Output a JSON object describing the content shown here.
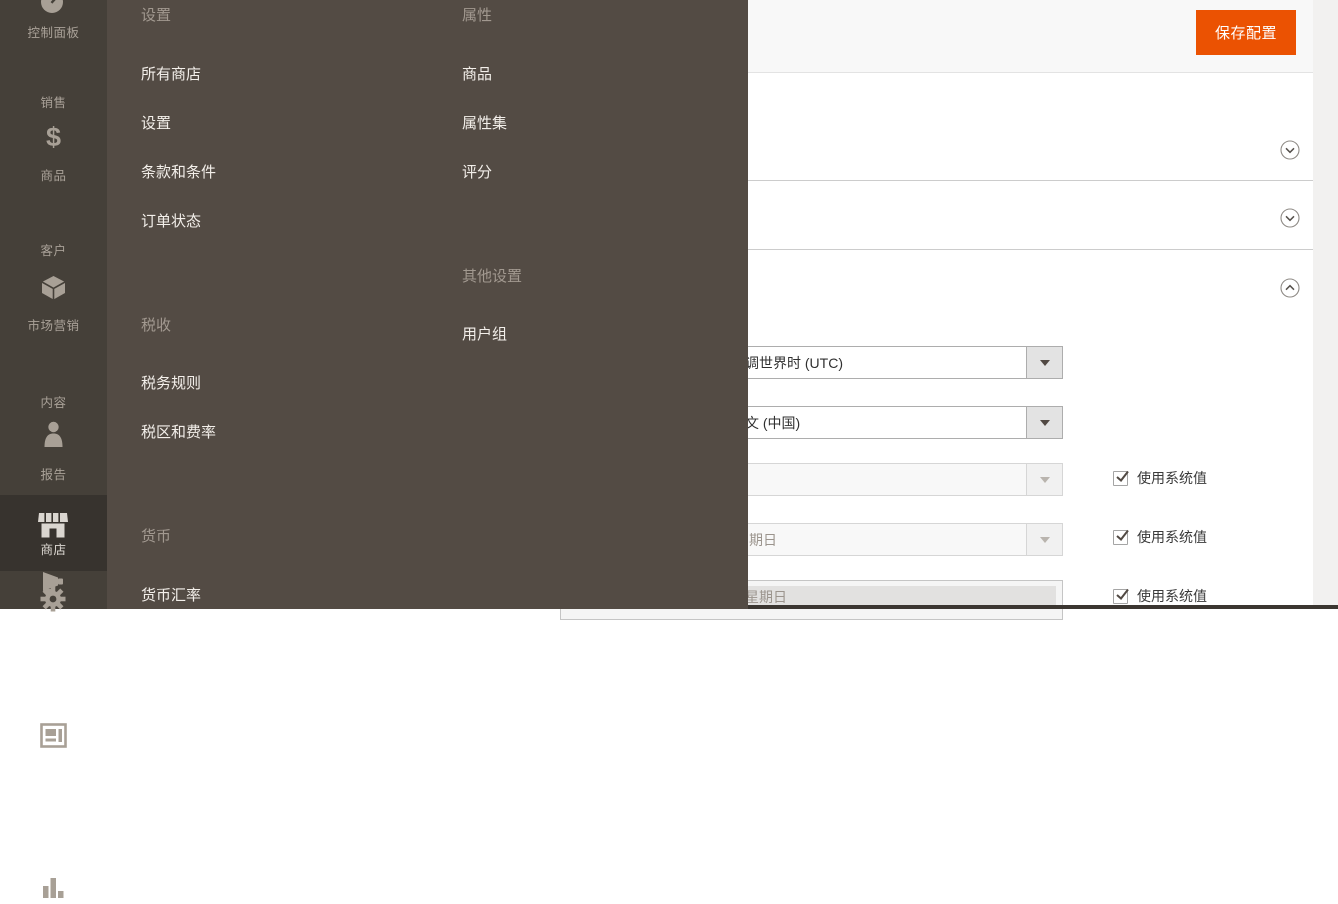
{
  "header": {
    "save_button": "保存配置"
  },
  "sidebar": {
    "items": [
      {
        "label": "控制面板",
        "icon": "dashboard-icon"
      },
      {
        "label": "销售",
        "icon": "sales-icon"
      },
      {
        "label": "商品",
        "icon": "products-icon"
      },
      {
        "label": "客户",
        "icon": "customers-icon"
      },
      {
        "label": "市场营销",
        "icon": "marketing-icon"
      },
      {
        "label": "内容",
        "icon": "content-icon"
      },
      {
        "label": "报告",
        "icon": "reports-icon"
      },
      {
        "label": "商店",
        "icon": "stores-icon",
        "selected": true
      },
      {
        "label": "",
        "icon": "gear-icon"
      }
    ]
  },
  "flyout": {
    "columns": [
      {
        "sections": [
          {
            "title": "设置",
            "items": [
              "所有商店",
              "设置",
              "条款和条件",
              "订单状态"
            ]
          },
          {
            "title": "税收",
            "items": [
              "税务规则",
              "税区和费率"
            ]
          },
          {
            "title": "货币",
            "items": [
              "货币汇率"
            ]
          }
        ]
      },
      {
        "sections": [
          {
            "title": "属性",
            "items": [
              "商品",
              "属性集",
              "评分"
            ]
          },
          {
            "title": "其他设置",
            "items": [
              "用户组"
            ]
          }
        ]
      }
    ]
  },
  "config_form": {
    "use_system_label": "使用系统值",
    "fields": [
      {
        "value": "调世界时 (UTC)",
        "disabled": false
      },
      {
        "value": "文 (中国)",
        "disabled": false
      },
      {
        "value": "",
        "disabled": true
      },
      {
        "value": "期日",
        "disabled": true
      },
      {
        "value": "星期日",
        "disabled": true
      }
    ]
  },
  "colors": {
    "accent_orange": "#eb5202",
    "sidebar_bg": "#454039",
    "sidebar_selected_bg": "#37332e",
    "flyout_bg": "#534b44",
    "header_band_bg": "#f8f8f8",
    "section_border": "#cccccc"
  }
}
